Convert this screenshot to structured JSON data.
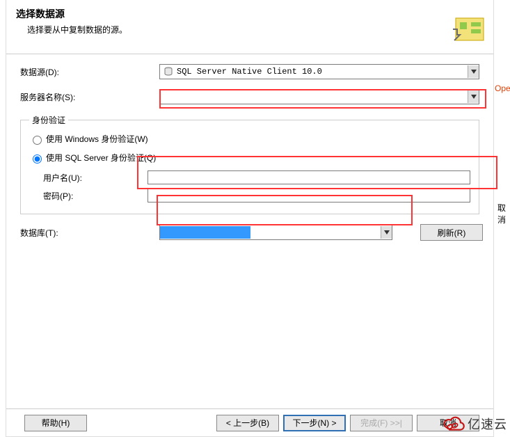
{
  "header": {
    "title": "选择数据源",
    "subtitle": "选择要从中复制数据的源。"
  },
  "labels": {
    "data_source": "数据源(D):",
    "server_name": "服务器名称(S):",
    "database": "数据库(T):"
  },
  "auth": {
    "legend": "身份验证",
    "windows_auth": "使用 Windows 身份验证(W)",
    "sql_auth": "使用 SQL Server 身份验证(Q)",
    "username_label": "用户名(U):",
    "password_label": "密码(P):",
    "username_value": "",
    "password_value": ""
  },
  "fields": {
    "data_source_value": "SQL Server Native Client 10.0",
    "server_name_value": "",
    "database_value": ""
  },
  "buttons": {
    "refresh": "刷新(R)",
    "help": "帮助(H)",
    "back": "< 上一步(B)",
    "next": "下一步(N) >",
    "finish": "完成(F) >>|",
    "cancel": "取消"
  },
  "cutoff": {
    "right_top": "Ope",
    "right_mid": "取消"
  },
  "watermark": {
    "text": "亿速云"
  }
}
